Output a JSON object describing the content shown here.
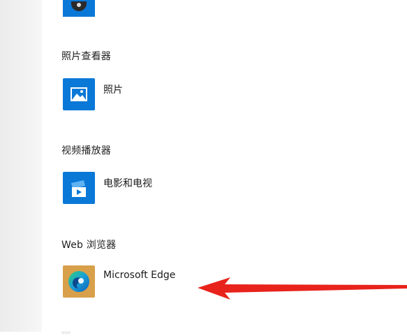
{
  "sections": [
    {
      "title": "照片查看器",
      "app": {
        "name": "照片",
        "icon": "photos-icon"
      }
    },
    {
      "title": "视频播放器",
      "app": {
        "name": "电影和电视",
        "icon": "movies-tv-icon"
      }
    },
    {
      "title": "Web 浏览器",
      "app": {
        "name": "Microsoft Edge",
        "icon": "edge-icon"
      }
    }
  ],
  "partial_top_icon": "groove-music-icon",
  "bottom_partial_text": "…",
  "annotation": {
    "type": "arrow",
    "color": "#e8231b",
    "points_to": "Microsoft Edge"
  }
}
